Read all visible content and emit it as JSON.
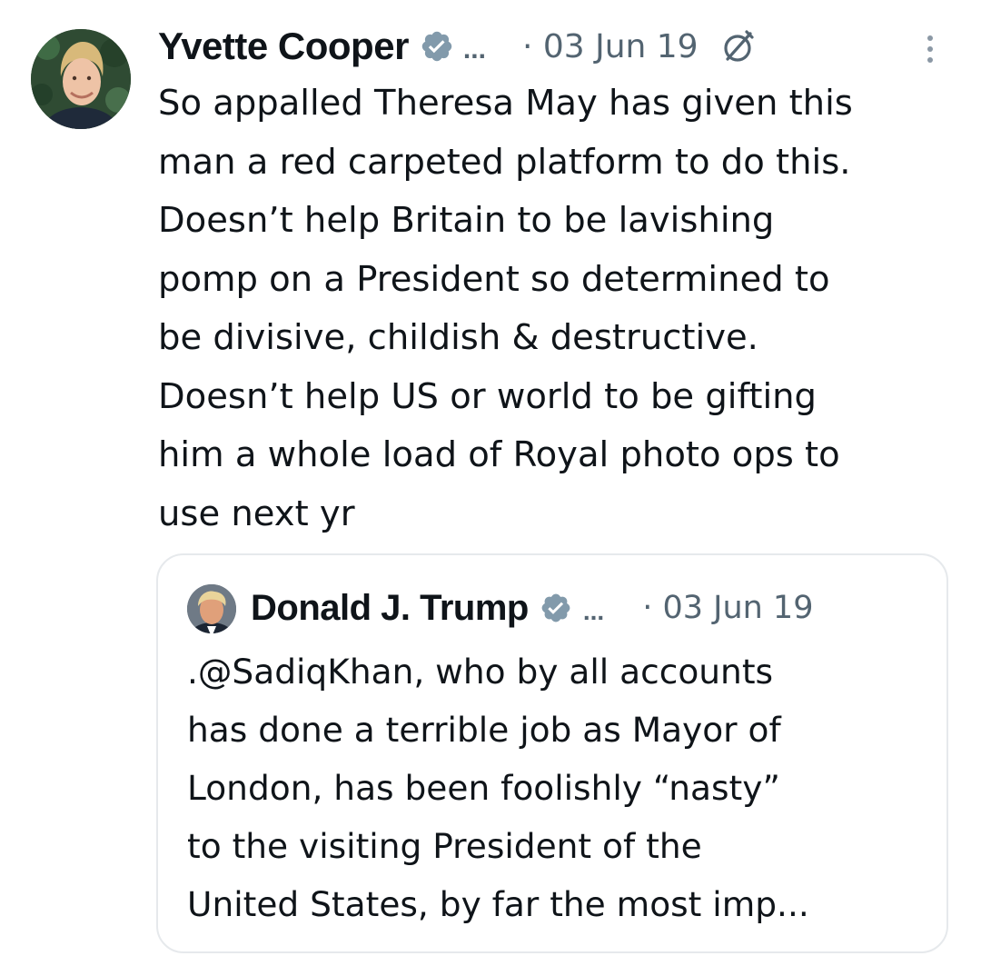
{
  "tweet": {
    "author": {
      "display_name": "Yvette Cooper",
      "verified_icon": "verified-badge-icon",
      "truncation": "...",
      "avatar": "profile-photo"
    },
    "date": "· 03 Jun 19",
    "edited_icon": "edited-pencil-icon",
    "more_icon": "more-options-icon",
    "text": "So appalled Theresa May has given this\nman a red carpeted platform to do this.\nDoesn’t help Britain to be lavishing\npomp on a President so determined to\nbe divisive, childish & destructive.\nDoesn’t help US or world to be gifting\nhim a whole load of Royal photo ops to\nuse next yr"
  },
  "quoted_tweet": {
    "author": {
      "display_name": "Donald J. Trump",
      "verified_icon": "verified-badge-icon",
      "truncation": "...",
      "avatar": "profile-photo"
    },
    "date": "· 03 Jun 19",
    "text": ".@SadiqKhan, who by all accounts\nhas done a terrible job as Mayor of\nLondon, has been foolishly “nasty”\nto the visiting President of the\nUnited States, by far the most imp..."
  },
  "colors": {
    "text_primary": "#0f1419",
    "text_secondary": "#536471",
    "verified_badge": "#829aab",
    "quote_border": "#e6e9ec"
  }
}
